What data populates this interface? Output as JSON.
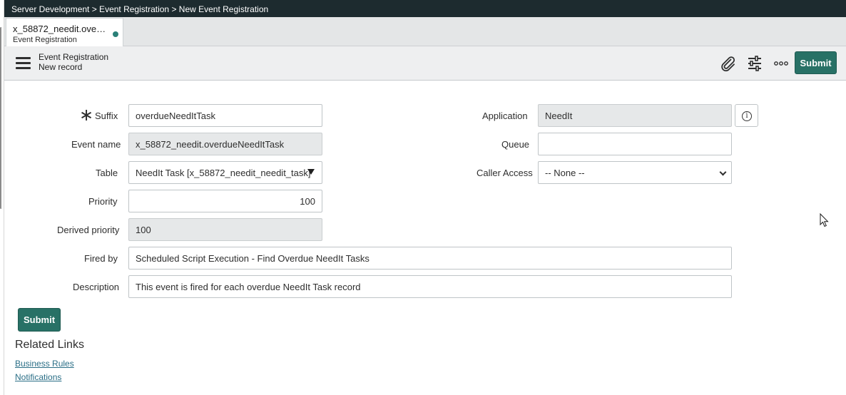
{
  "breadcrumb": "Server Development > Event Registration > New Event Registration",
  "tab": {
    "title": "x_58872_needit.ove…",
    "subtitle": "Event Registration"
  },
  "header": {
    "title": "Event Registration",
    "subtitle": "New record",
    "submit_label": "Submit"
  },
  "icons": {
    "attach": "paperclip-icon",
    "settings": "sliders-icon",
    "more": "more-options-icon",
    "menu": "hamburger-menu-icon",
    "info": "info-icon"
  },
  "form": {
    "suffix_label": "Suffix",
    "suffix_value": "overdueNeedItTask",
    "event_name_label": "Event name",
    "event_name_value": "x_58872_needit.overdueNeedItTask",
    "table_label": "Table",
    "table_value": "NeedIt Task [x_58872_needit_needit_task]",
    "priority_label": "Priority",
    "priority_value": "100",
    "derived_priority_label": "Derived priority",
    "derived_priority_value": "100",
    "fired_by_label": "Fired by",
    "fired_by_value": "Scheduled Script Execution - Find Overdue NeedIt Tasks",
    "description_label": "Description",
    "description_value": "This event is fired for each overdue NeedIt Task record",
    "application_label": "Application",
    "application_value": "NeedIt",
    "queue_label": "Queue",
    "queue_value": "",
    "caller_access_label": "Caller Access",
    "caller_access_value": "-- None --"
  },
  "bottom_submit_label": "Submit",
  "related": {
    "title": "Related Links",
    "links": [
      "Business Rules",
      "Notifications"
    ]
  },
  "colors": {
    "accent": "#287166",
    "topbar": "#1d2b2f",
    "link": "#2a6e86"
  }
}
